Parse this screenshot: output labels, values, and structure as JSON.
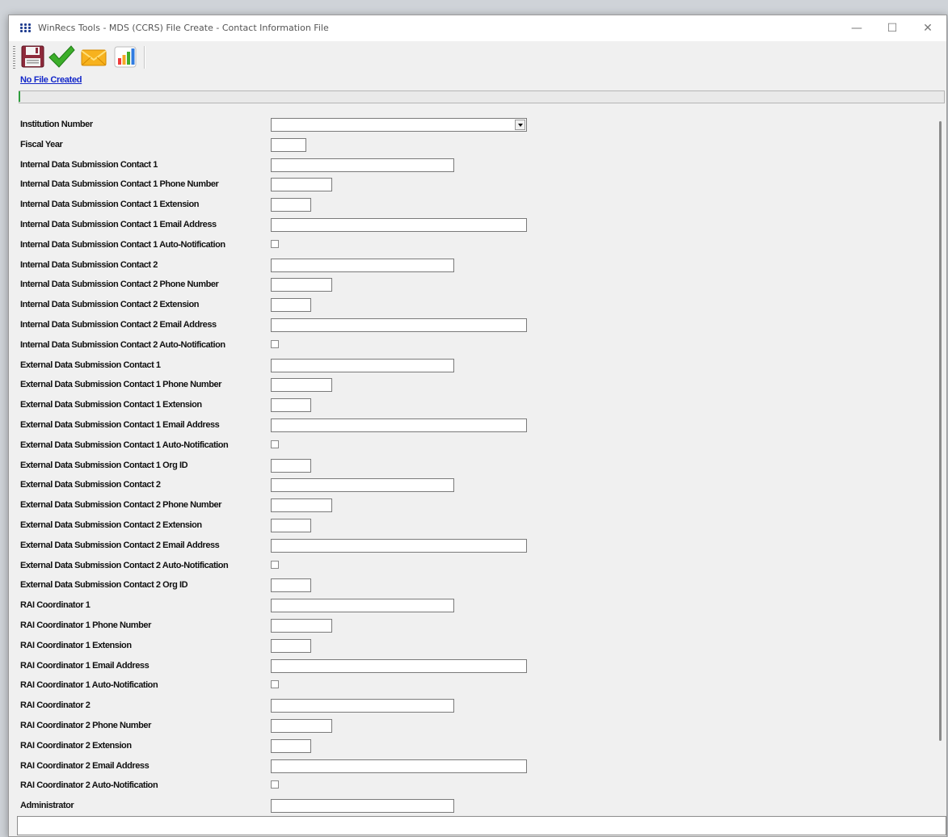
{
  "window": {
    "title": "WinRecs Tools - MDS (CCRS) File Create - Contact Information File",
    "controls": {
      "minimize": "—",
      "maximize": "☐",
      "close": "✕"
    }
  },
  "toolbar": {
    "buttons": [
      {
        "name": "save-icon",
        "tooltip": ""
      },
      {
        "name": "checkmark-icon",
        "tooltip": ""
      },
      {
        "name": "envelope-icon",
        "tooltip": ""
      },
      {
        "name": "bar-chart-icon",
        "tooltip": ""
      }
    ]
  },
  "status_link": "No File Created",
  "form": {
    "rows": [
      {
        "label": "Institution Number",
        "kind": "dropdown",
        "size": "xl",
        "value": ""
      },
      {
        "label": "Fiscal Year",
        "kind": "text",
        "size": "xs",
        "value": ""
      },
      {
        "label": "Internal Data Submission Contact 1",
        "kind": "text",
        "size": "l",
        "value": ""
      },
      {
        "label": "Internal Data Submission Contact 1 Phone Number",
        "kind": "text",
        "size": "m",
        "value": ""
      },
      {
        "label": "Internal Data Submission Contact 1 Extension",
        "kind": "text",
        "size": "s",
        "value": ""
      },
      {
        "label": "Internal Data Submission Contact 1 Email Address",
        "kind": "text",
        "size": "xl",
        "value": ""
      },
      {
        "label": "Internal Data Submission Contact 1 Auto-Notification",
        "kind": "checkbox",
        "checked": false
      },
      {
        "label": "Internal Data Submission Contact 2",
        "kind": "text",
        "size": "l",
        "value": ""
      },
      {
        "label": "Internal Data Submission Contact 2 Phone Number",
        "kind": "text",
        "size": "m",
        "value": ""
      },
      {
        "label": "Internal Data Submission Contact 2 Extension",
        "kind": "text",
        "size": "s",
        "value": ""
      },
      {
        "label": "Internal Data Submission Contact 2 Email Address",
        "kind": "text",
        "size": "xl",
        "value": ""
      },
      {
        "label": "Internal Data Submission Contact 2 Auto-Notification",
        "kind": "checkbox",
        "checked": false
      },
      {
        "label": "External Data Submission Contact 1",
        "kind": "text",
        "size": "l",
        "value": ""
      },
      {
        "label": "External Data Submission Contact 1 Phone Number",
        "kind": "text",
        "size": "m",
        "value": ""
      },
      {
        "label": "External Data Submission Contact 1 Extension",
        "kind": "text",
        "size": "s",
        "value": ""
      },
      {
        "label": "External Data Submission Contact 1 Email Address",
        "kind": "text",
        "size": "xl",
        "value": ""
      },
      {
        "label": "External Data Submission Contact 1 Auto-Notification",
        "kind": "checkbox",
        "checked": false
      },
      {
        "label": "External Data Submission Contact 1 Org ID",
        "kind": "text",
        "size": "s",
        "value": ""
      },
      {
        "label": "External Data Submission Contact 2",
        "kind": "text",
        "size": "l",
        "value": ""
      },
      {
        "label": "External Data Submission Contact 2 Phone Number",
        "kind": "text",
        "size": "m",
        "value": ""
      },
      {
        "label": "External Data Submission Contact 2 Extension",
        "kind": "text",
        "size": "s",
        "value": ""
      },
      {
        "label": "External Data Submission Contact 2 Email Address",
        "kind": "text",
        "size": "xl",
        "value": ""
      },
      {
        "label": "External Data Submission Contact 2 Auto-Notification",
        "kind": "checkbox",
        "checked": false
      },
      {
        "label": "External Data Submission Contact 2 Org ID",
        "kind": "text",
        "size": "s",
        "value": ""
      },
      {
        "label": "RAI Coordinator 1",
        "kind": "text",
        "size": "l",
        "value": ""
      },
      {
        "label": "RAI Coordinator 1 Phone Number",
        "kind": "text",
        "size": "m",
        "value": ""
      },
      {
        "label": "RAI Coordinator 1 Extension",
        "kind": "text",
        "size": "s",
        "value": ""
      },
      {
        "label": "RAI Coordinator 1 Email Address",
        "kind": "text",
        "size": "xl",
        "value": ""
      },
      {
        "label": "RAI Coordinator 1 Auto-Notification",
        "kind": "checkbox",
        "checked": false
      },
      {
        "label": "RAI Coordinator 2",
        "kind": "text",
        "size": "l",
        "value": ""
      },
      {
        "label": "RAI Coordinator 2 Phone Number",
        "kind": "text",
        "size": "m",
        "value": ""
      },
      {
        "label": "RAI Coordinator 2 Extension",
        "kind": "text",
        "size": "s",
        "value": ""
      },
      {
        "label": "RAI Coordinator 2 Email Address",
        "kind": "text",
        "size": "xl",
        "value": ""
      },
      {
        "label": "RAI Coordinator 2 Auto-Notification",
        "kind": "checkbox",
        "checked": false
      },
      {
        "label": "Administrator",
        "kind": "text",
        "size": "l",
        "value": ""
      }
    ]
  },
  "statusbar": {
    "text": ""
  }
}
